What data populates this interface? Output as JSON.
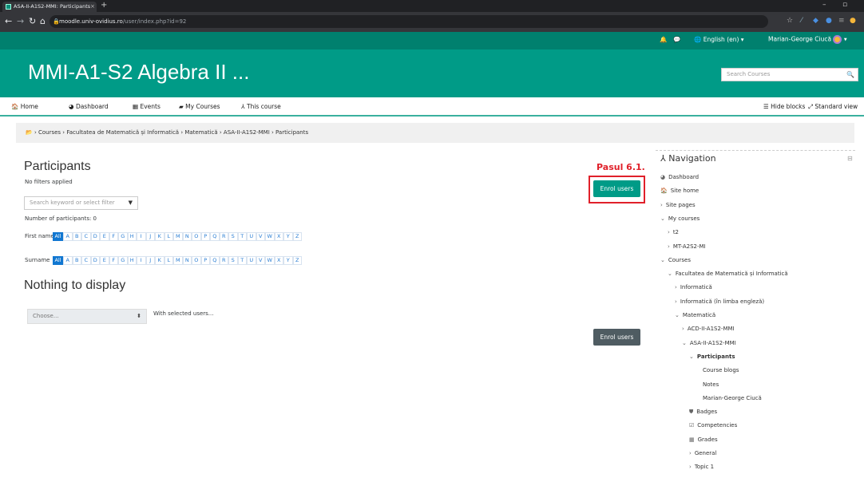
{
  "browser": {
    "tab_title": "ASA-II-A1S2-MMI: Participants",
    "tab_close": "×",
    "new_tab": "+",
    "url_host": "moodle.univ-ovidius.ro",
    "url_path": "/user/index.php?id=92"
  },
  "topbar": {
    "language": "English (en) ▾",
    "user_name": "Marian-George Ciucă"
  },
  "header": {
    "course_title": "MMI-A1-S2 Algebra II ...",
    "search_placeholder": "Search Courses"
  },
  "menu": {
    "home": "Home",
    "dashboard": "Dashboard",
    "events": "Events",
    "my_courses": "My Courses",
    "this_course": "This course",
    "hide_blocks": "Hide blocks",
    "standard_view": "Standard view"
  },
  "breadcrumb": {
    "items": [
      "Courses",
      "Facultatea de Matematică și Informatică",
      "Matematică",
      "ASA-II-A1S2-MMI",
      "Participants"
    ]
  },
  "main": {
    "title": "Participants",
    "filters": "No filters applied",
    "filter_placeholder": "Search keyword or select filter",
    "count": "Number of participants: 0",
    "first_name_label": "First name",
    "surname_label": "Surname",
    "all_label": "All",
    "letters": [
      "A",
      "B",
      "C",
      "D",
      "E",
      "F",
      "G",
      "H",
      "I",
      "J",
      "K",
      "L",
      "M",
      "N",
      "O",
      "P",
      "Q",
      "R",
      "S",
      "T",
      "U",
      "V",
      "W",
      "X",
      "Y",
      "Z"
    ],
    "empty": "Nothing to display",
    "choose": "Choose...",
    "with_selected": "With selected users...",
    "enrol_button": "Enrol users",
    "enrol_button_bottom": "Enrol users"
  },
  "annotation": {
    "label": "Pasul 6.1."
  },
  "navigation": {
    "title": "Navigation",
    "items": [
      {
        "label": "Dashboard",
        "icon": "dashboard-icon"
      },
      {
        "label": "Site home",
        "icon": "home-icon"
      },
      {
        "label": "Site pages",
        "icon": "chevron-right"
      },
      {
        "label": "My courses",
        "icon": "chevron-down"
      },
      {
        "label": "t2",
        "icon": "chevron-right"
      },
      {
        "label": "MT-A2S2-MI",
        "icon": "chevron-right"
      },
      {
        "label": "Courses",
        "icon": "chevron-down"
      },
      {
        "label": "Facultatea de Matematică și Informatică",
        "icon": "chevron-down"
      },
      {
        "label": "Informatică",
        "icon": "chevron-right"
      },
      {
        "label": "Informatică (în limba engleză)",
        "icon": "chevron-right"
      },
      {
        "label": "Matematică",
        "icon": "chevron-down"
      },
      {
        "label": "ACD-II-A1S2-MMI",
        "icon": "chevron-right"
      },
      {
        "label": "ASA-II-A1S2-MMI",
        "icon": "chevron-down"
      },
      {
        "label": "Participants",
        "icon": "chevron-down"
      },
      {
        "label": "Course blogs",
        "icon": ""
      },
      {
        "label": "Notes",
        "icon": ""
      },
      {
        "label": "Marian-George Ciucă",
        "icon": ""
      },
      {
        "label": "Badges",
        "icon": "shield-icon"
      },
      {
        "label": "Competencies",
        "icon": "checkbox-icon"
      },
      {
        "label": "Grades",
        "icon": "table-icon"
      },
      {
        "label": "General",
        "icon": "chevron-right"
      },
      {
        "label": "Topic 1",
        "icon": "chevron-right"
      }
    ]
  }
}
